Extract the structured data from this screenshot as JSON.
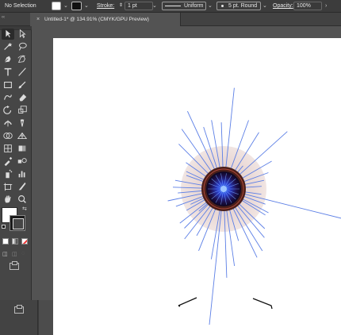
{
  "control_bar": {
    "selection_label": "No Selection",
    "stroke_label": "Stroke:",
    "stroke_weight": "1 pt",
    "profile_label": "Uniform",
    "brush_label": "5 pt. Round",
    "opacity_label": "Opacity:",
    "opacity_value": "100%"
  },
  "document_tab": {
    "close_glyph": "×",
    "title": "Untitled-1* @ 134.91% (CMYK/GPU Preview)"
  },
  "toolbar": {
    "collapse_glyph": "‹‹",
    "tools": [
      "selection-tool-icon",
      "direct-selection-tool-icon",
      "magic-wand-tool-icon",
      "lasso-tool-icon",
      "pen-tool-icon",
      "curvature-tool-icon",
      "type-tool-icon",
      "line-segment-tool-icon",
      "rectangle-tool-icon",
      "paintbrush-tool-icon",
      "shaper-tool-icon",
      "eraser-tool-icon",
      "rotate-tool-icon",
      "scale-tool-icon",
      "width-tool-icon",
      "puppet-warp-tool-icon",
      "shape-builder-tool-icon",
      "perspective-grid-tool-icon",
      "mesh-tool-icon",
      "gradient-tool-icon",
      "eyedropper-tool-icon",
      "blend-tool-icon",
      "symbol-sprayer-tool-icon",
      "column-graph-tool-icon",
      "artboard-tool-icon",
      "slice-tool-icon",
      "hand-tool-icon",
      "zoom-tool-icon"
    ]
  },
  "colors": {
    "ray_stroke": "#5c7fe6",
    "iris_outer": "#e8d6d3",
    "pupil_ring": "#4a1f1a",
    "pupil_core": "#1c0f4a",
    "pupil_center": "#3d7dff",
    "accent_red": "#e33"
  }
}
